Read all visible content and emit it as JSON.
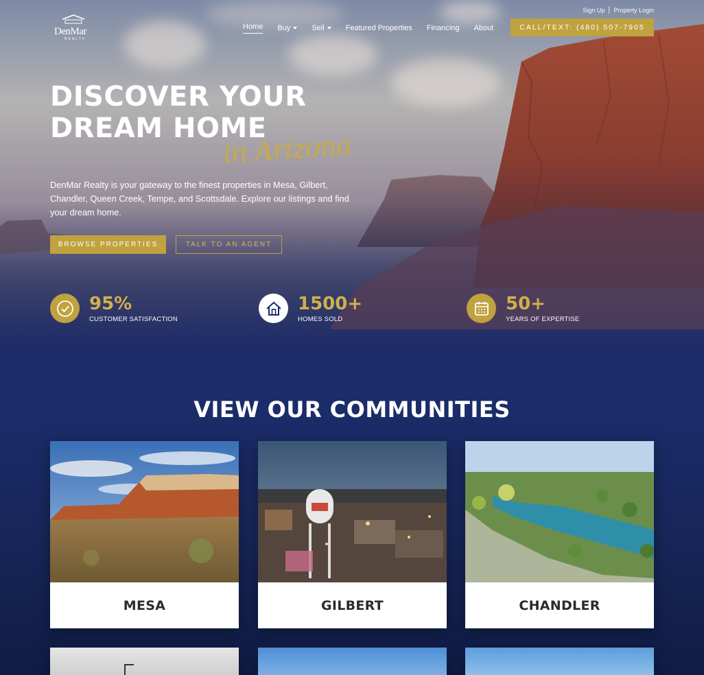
{
  "top_links": {
    "sign_up": "Sign Up",
    "property_login": "Property Login"
  },
  "logo": {
    "brand": "DenMar",
    "sub": "REALTY"
  },
  "nav": {
    "items": [
      {
        "label": "Home",
        "active": true,
        "dropdown": false
      },
      {
        "label": "Buy",
        "active": false,
        "dropdown": true
      },
      {
        "label": "Sell",
        "active": false,
        "dropdown": true
      },
      {
        "label": "Featured Properties",
        "active": false,
        "dropdown": false
      },
      {
        "label": "Financing",
        "active": false,
        "dropdown": false
      },
      {
        "label": "About",
        "active": false,
        "dropdown": false
      }
    ],
    "call_button": "CALL/TEXT: (480) 507-7905"
  },
  "hero": {
    "title_line1": "DISCOVER YOUR",
    "title_line2": "DREAM HOME",
    "script": "in Arizona",
    "description": "DenMar Realty is your gateway to the finest properties in Mesa, Gilbert, Chandler, Queen Creek, Tempe, and Scottsdale. Explore our listings and find your dream home.",
    "primary_button": "BROWSE PROPERTIES",
    "secondary_button": "TALK TO AN AGENT"
  },
  "stats": [
    {
      "value": "95%",
      "label": "CUSTOMER SATISFACTION",
      "icon": "check-circle-icon"
    },
    {
      "value": "1500+",
      "label": "HOMES SOLD",
      "icon": "house-icon"
    },
    {
      "value": "50+",
      "label": "YEARS OF EXPERTISE",
      "icon": "calendar-icon"
    }
  ],
  "communities": {
    "title": "VIEW OUR COMMUNITIES",
    "cards": [
      {
        "name": "MESA"
      },
      {
        "name": "GILBERT"
      },
      {
        "name": "CHANDLER"
      }
    ]
  },
  "colors": {
    "gold": "#c0a23e",
    "navy": "#1b2c6a",
    "card_text": "#2b2b2b"
  }
}
